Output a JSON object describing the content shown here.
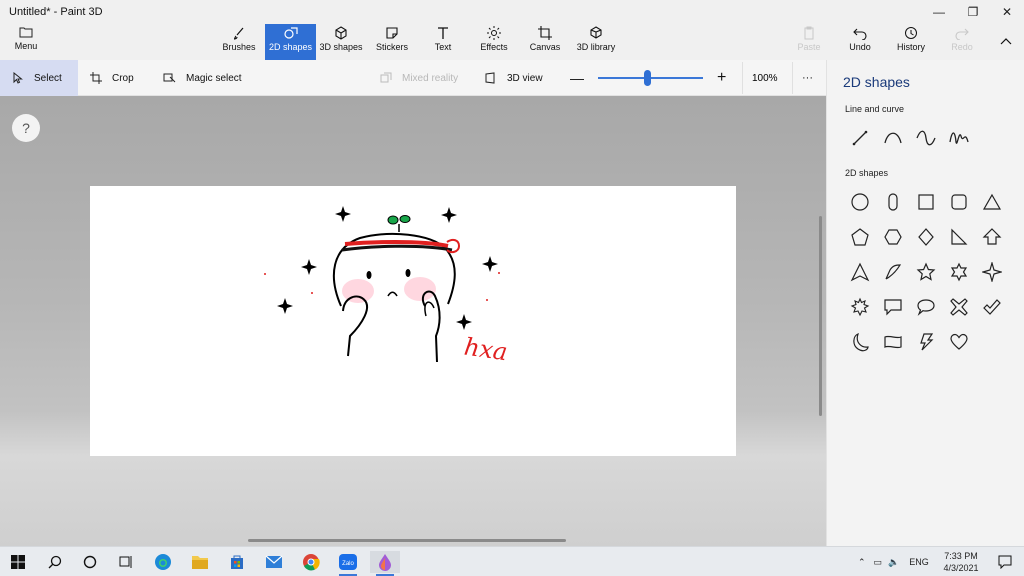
{
  "window": {
    "title": "Untitled* - Paint 3D"
  },
  "ribbon": {
    "menu_label": "Menu",
    "tools": [
      {
        "label": "Brushes"
      },
      {
        "label": "2D shapes"
      },
      {
        "label": "3D shapes"
      },
      {
        "label": "Stickers"
      },
      {
        "label": "Text"
      },
      {
        "label": "Effects"
      },
      {
        "label": "Canvas"
      },
      {
        "label": "3D library"
      }
    ],
    "paste_label": "Paste",
    "undo_label": "Undo",
    "history_label": "History",
    "redo_label": "Redo"
  },
  "subbar": {
    "select_label": "Select",
    "crop_label": "Crop",
    "magic_select_label": "Magic select",
    "mixed_reality_label": "Mixed reality",
    "view3d_label": "3D view",
    "zoom_label": "100%",
    "zoom_level": 0.47,
    "more_label": "···"
  },
  "workspace": {
    "help_label": "?",
    "signature_text": "hxa"
  },
  "panel": {
    "title": "2D shapes",
    "line_section": "Line and curve",
    "shapes_section": "2D shapes",
    "line_tools": [
      "line-icon",
      "curve-icon",
      "three-point-curve-icon",
      "four-point-curve-icon"
    ],
    "shape_tools": [
      "circle-icon",
      "oval-icon",
      "square-icon",
      "rounded-square-icon",
      "triangle-icon",
      "pentagon-icon",
      "hexagon-icon",
      "diamond-icon",
      "right-triangle-icon",
      "arrow-up-icon",
      "triangle-outline-icon",
      "quarter-circle-icon",
      "star-icon",
      "star-6-icon",
      "star-4-icon",
      "burst-icon",
      "speech-rect-icon",
      "speech-oval-icon",
      "x-icon",
      "check-icon",
      "moon-icon",
      "wave-rect-icon",
      "lightning-icon",
      "heart-icon"
    ]
  },
  "taskbar": {
    "language": "ENG",
    "time": "7:33 PM",
    "date": "4/3/2021"
  },
  "colors": {
    "accent": "#2f6fd4",
    "panel_title": "#1a3a7a",
    "drawing_red": "#e02020",
    "drawing_green": "#19a64a",
    "blush": "#ffc9d6"
  }
}
